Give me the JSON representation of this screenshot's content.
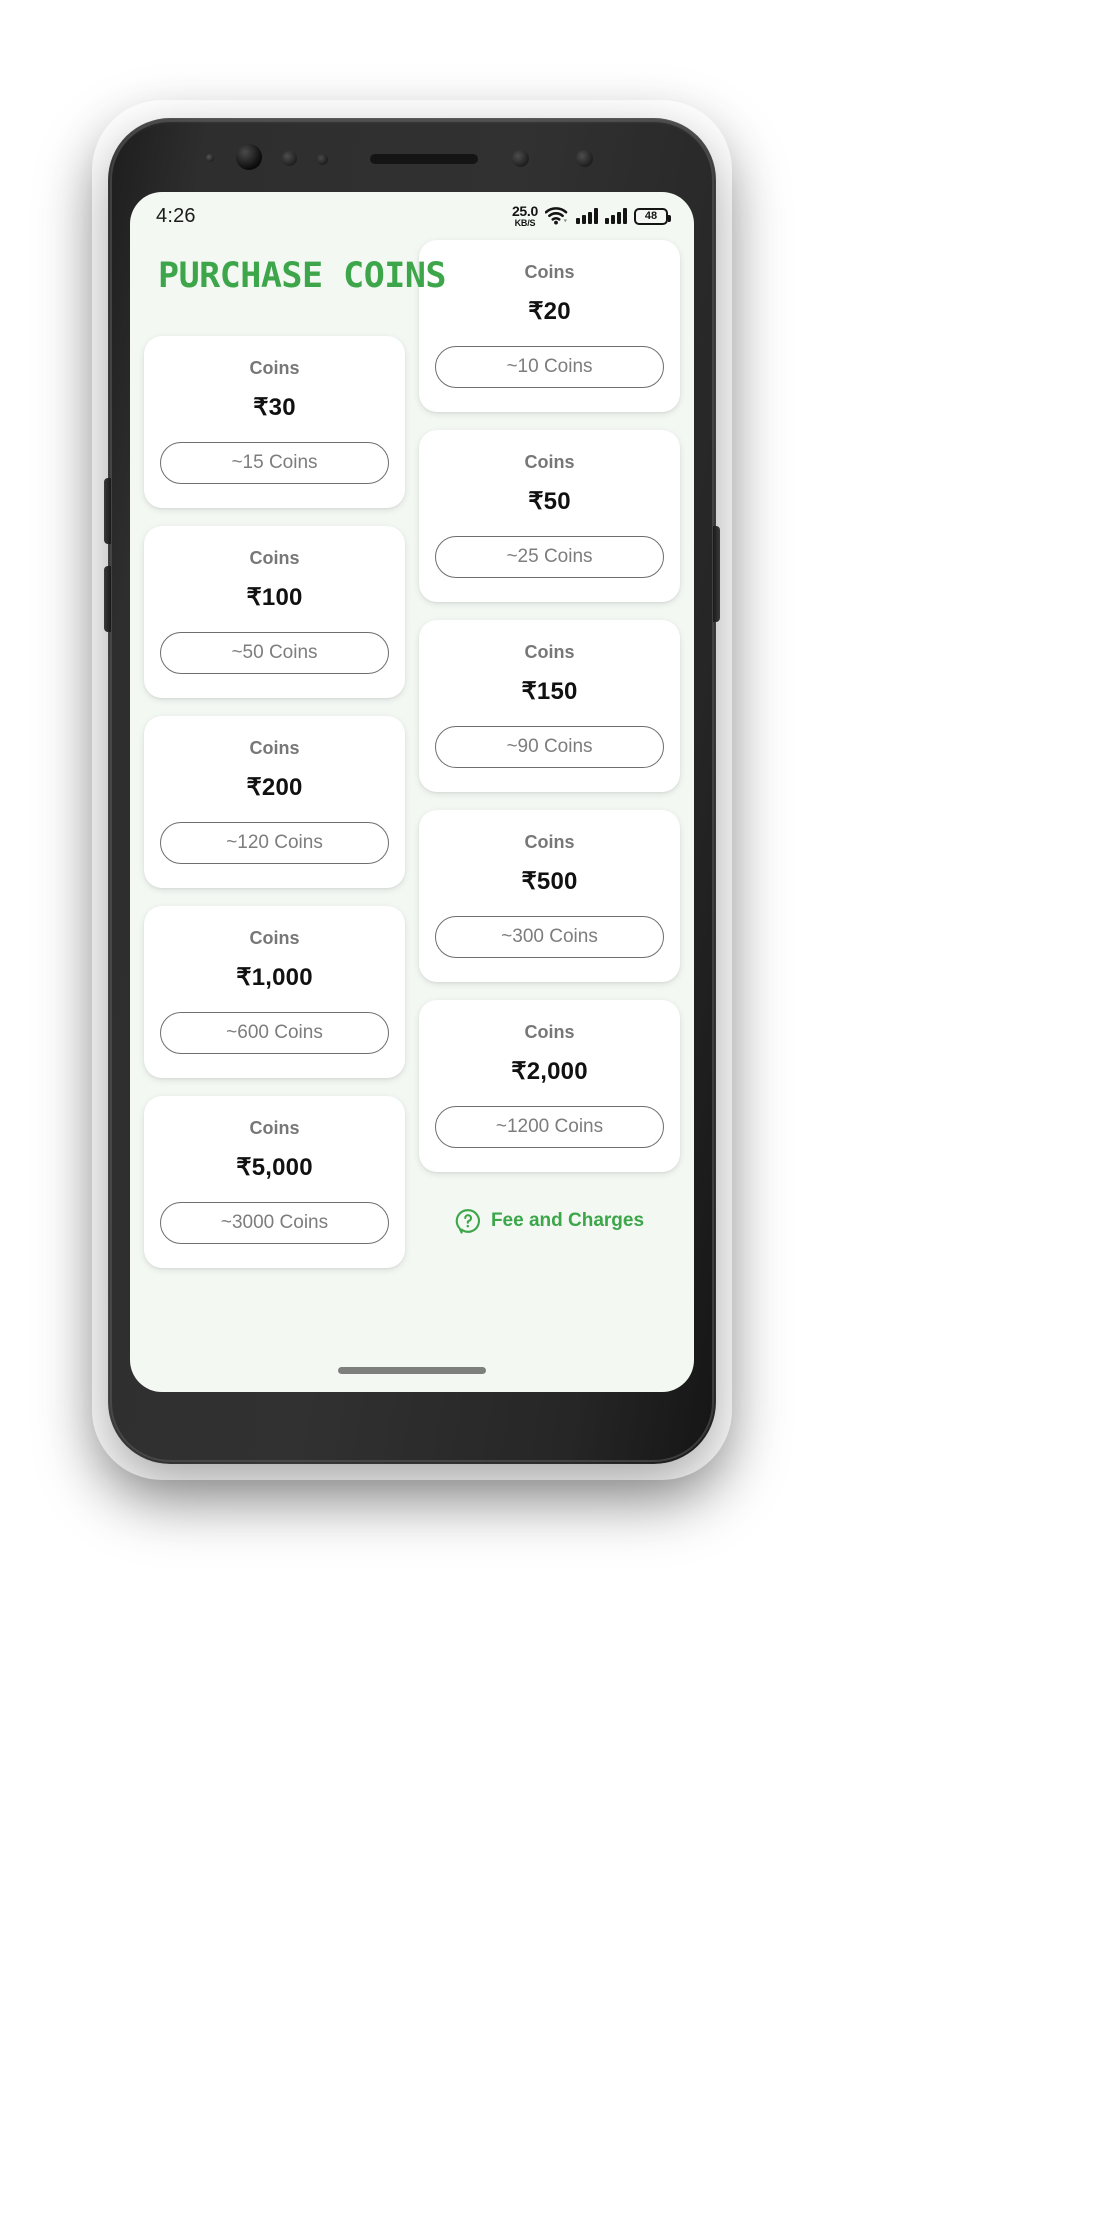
{
  "statusbar": {
    "clock": "4:26",
    "net_speed_value": "25.0",
    "net_speed_unit": "KB/S",
    "wifi_icon": "wifi-icon",
    "signal_icon_1": "signal-bars-icon",
    "signal_icon_2": "signal-bars-icon",
    "battery_level": "48"
  },
  "header": {
    "title": "PURCHASE COINS"
  },
  "theme": {
    "accent_green": "#3da64a",
    "screen_background": "#f3f8f3",
    "card_background": "#ffffff",
    "label_gray": "#777777",
    "pill_gray": "#7d7d7d",
    "price_black": "#111111"
  },
  "left_column": [
    {
      "label": "Coins",
      "price": "₹30",
      "pill": "~15 Coins"
    },
    {
      "label": "Coins",
      "price": "₹100",
      "pill": "~50 Coins"
    },
    {
      "label": "Coins",
      "price": "₹200",
      "pill": "~120 Coins"
    },
    {
      "label": "Coins",
      "price": "₹1,000",
      "pill": "~600 Coins"
    },
    {
      "label": "Coins",
      "price": "₹5,000",
      "pill": "~3000 Coins"
    }
  ],
  "right_column": [
    {
      "label": "Coins",
      "price": "₹20",
      "pill": "~10 Coins"
    },
    {
      "label": "Coins",
      "price": "₹50",
      "pill": "~25 Coins"
    },
    {
      "label": "Coins",
      "price": "₹150",
      "pill": "~90 Coins"
    },
    {
      "label": "Coins",
      "price": "₹500",
      "pill": "~300 Coins"
    },
    {
      "label": "Coins",
      "price": "₹2,000",
      "pill": "~1200 Coins"
    }
  ],
  "footer": {
    "fee_icon": "question-mark-bubble-icon",
    "fee_label": "Fee and Charges"
  },
  "navigation": {
    "home_indicator": "home-indicator"
  }
}
